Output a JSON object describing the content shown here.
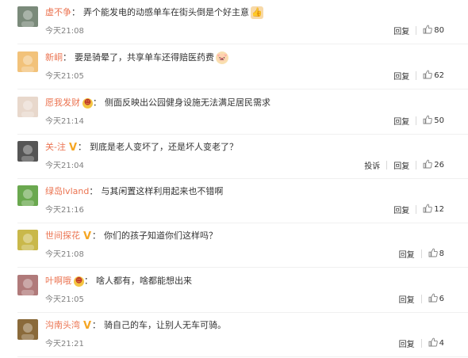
{
  "comments": [
    {
      "username": "虚不争",
      "text": "弄个能发电的动感单车在街头倒是个好主意",
      "emoji": "👍",
      "emoji_name": "thumbs-up-emoji",
      "time": "今天21:08",
      "report_label": "",
      "reply_label": "回复",
      "likes": "80",
      "avatar_color": "#7a8a7a"
    },
    {
      "username": "新峒",
      "text": "要是骑晕了，共享单车还得赔医药费",
      "emoji": "🐷",
      "emoji_name": "pig-face-emoji",
      "time": "今天21:05",
      "report_label": "",
      "reply_label": "回复",
      "likes": "62",
      "avatar_color": "#f2c27a"
    },
    {
      "username": "愿我发财",
      "badge": "rich",
      "text": "侧面反映出公园健身设施无法满足居民需求",
      "time": "今天21:14",
      "report_label": "",
      "reply_label": "回复",
      "likes": "50",
      "avatar_color": "#e8d8cc"
    },
    {
      "username": "关-注",
      "badge": "v",
      "text": "到底是老人变坏了，还是坏人变老了？",
      "time": "今天21:04",
      "report_label": "投诉",
      "reply_label": "回复",
      "likes": "26",
      "avatar_color": "#555555"
    },
    {
      "username": "绿岛lvland",
      "text": "与其闲置这样利用起来也不错啊",
      "time": "今天21:16",
      "report_label": "",
      "reply_label": "回复",
      "likes": "12",
      "avatar_color": "#6aa84f"
    },
    {
      "username": "世间探花",
      "badge": "v",
      "text": "你们的孩子知道你们这样吗？",
      "time": "今天21:08",
      "report_label": "",
      "reply_label": "回复",
      "likes": "8",
      "avatar_color": "#c9b84a"
    },
    {
      "username": "叶啊哦",
      "badge": "rich",
      "text": "啥人都有，啥都能想出来",
      "time": "今天21:05",
      "report_label": "",
      "reply_label": "回复",
      "likes": "6",
      "avatar_color": "#b07a7a"
    },
    {
      "username": "沟南头湾",
      "badge": "v",
      "text": "骑自己的车，让别人无车可骑。",
      "time": "今天21:21",
      "report_label": "",
      "reply_label": "回复",
      "likes": "4",
      "avatar_color": "#8a6a3a"
    }
  ],
  "colors": {
    "username": "#eb7350",
    "time": "#808080",
    "text": "#333333",
    "like_icon": "#808080"
  }
}
